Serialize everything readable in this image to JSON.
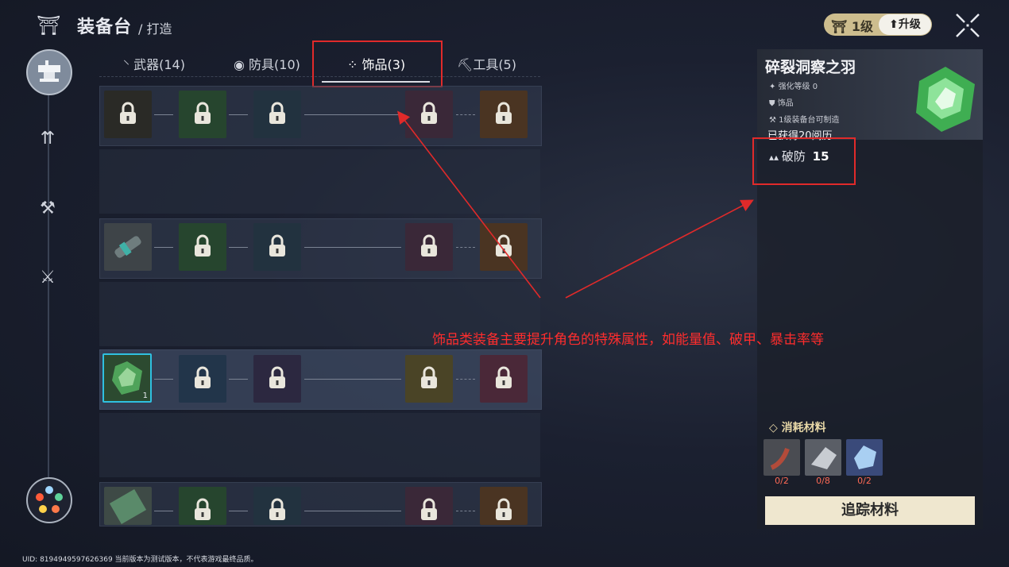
{
  "header": {
    "title": "装备台",
    "subtitle": "/ 打造",
    "level_label": "1级",
    "upgrade_label": "升级"
  },
  "tabs": [
    {
      "label": "武器(14)",
      "icon": "sword-icon",
      "active": false
    },
    {
      "label": "防具(10)",
      "icon": "shield-dot-icon",
      "active": false
    },
    {
      "label": "饰品(3)",
      "icon": "diamond-cross-icon",
      "active": true
    },
    {
      "label": "工具(5)",
      "icon": "pickaxe-icon",
      "active": false
    }
  ],
  "grid": {
    "selected_slot_count": "1"
  },
  "item": {
    "name": "碎裂洞察之羽",
    "enhance_level": "强化等级 0",
    "category": "饰品",
    "requirement": "1级装备台可制造",
    "obtained": "已获得20阅历",
    "stat_name": "破防",
    "stat_value": "15"
  },
  "materials": {
    "title": "消耗材料",
    "items": [
      {
        "count": "0/2",
        "icon": "bone-claw-icon"
      },
      {
        "count": "0/8",
        "icon": "metal-shard-icon"
      },
      {
        "count": "0/2",
        "icon": "ice-crystal-icon"
      }
    ],
    "track_label": "追踪材料"
  },
  "annotation": "饰品类装备主要提升角色的特殊属性，如能量值、破甲、暴击率等",
  "footer": "UID: 8194949597626369 当前版本为测试版本，不代表游戏最终品质。",
  "colors": {
    "annotation_red": "#e02a2a",
    "selected_cyan": "#2fc0e0",
    "gold": "#cdbd8e"
  }
}
